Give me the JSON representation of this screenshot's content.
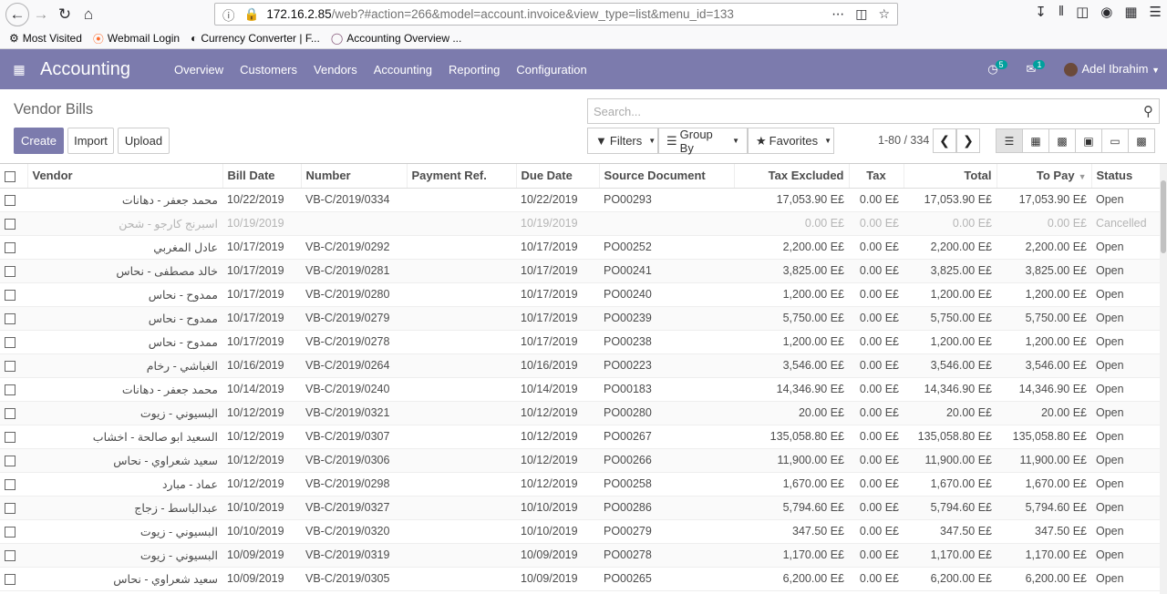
{
  "browser": {
    "url_host": "172.16.2.85",
    "url_path": "/web?#action=266&model=account.invoice&view_type=list&menu_id=133",
    "bookmarks": [
      "Most Visited",
      "Webmail Login",
      "Currency Converter | F...",
      "Accounting Overview ..."
    ]
  },
  "nav": {
    "app_name": "Accounting",
    "menu": [
      "Overview",
      "Customers",
      "Vendors",
      "Accounting",
      "Reporting",
      "Configuration"
    ],
    "activity_count": "5",
    "message_count": "1",
    "user_name": "Adel Ibrahim"
  },
  "control_panel": {
    "title": "Vendor Bills",
    "create_label": "Create",
    "import_label": "Import",
    "upload_label": "Upload",
    "search_placeholder": "Search...",
    "filters_label": "Filters",
    "groupby_label": "Group By",
    "favorites_label": "Favorites",
    "pager": "1-80 / 334"
  },
  "table": {
    "headers": [
      "Vendor",
      "Bill Date",
      "Number",
      "Payment Ref.",
      "Due Date",
      "Source Document",
      "Tax Excluded",
      "Tax",
      "Total",
      "To Pay",
      "Status"
    ],
    "rows": [
      [
        "محمد جعفر - دهانات",
        "10/22/2019",
        "VB-C/2019/0334",
        "",
        "10/22/2019",
        "PO00293",
        "17,053.90 E£",
        "0.00 E£",
        "17,053.90 E£",
        "17,053.90 E£",
        "Open"
      ],
      [
        "اسبرنج كارجو - شحن",
        "10/19/2019",
        "",
        "",
        "10/19/2019",
        "",
        "0.00 E£",
        "0.00 E£",
        "0.00 E£",
        "0.00 E£",
        "Cancelled"
      ],
      [
        "عادل المغربي",
        "10/17/2019",
        "VB-C/2019/0292",
        "",
        "10/17/2019",
        "PO00252",
        "2,200.00 E£",
        "0.00 E£",
        "2,200.00 E£",
        "2,200.00 E£",
        "Open"
      ],
      [
        "خالد مصطفى - نحاس",
        "10/17/2019",
        "VB-C/2019/0281",
        "",
        "10/17/2019",
        "PO00241",
        "3,825.00 E£",
        "0.00 E£",
        "3,825.00 E£",
        "3,825.00 E£",
        "Open"
      ],
      [
        "ممدوح - نحاس",
        "10/17/2019",
        "VB-C/2019/0280",
        "",
        "10/17/2019",
        "PO00240",
        "1,200.00 E£",
        "0.00 E£",
        "1,200.00 E£",
        "1,200.00 E£",
        "Open"
      ],
      [
        "ممدوح - نحاس",
        "10/17/2019",
        "VB-C/2019/0279",
        "",
        "10/17/2019",
        "PO00239",
        "5,750.00 E£",
        "0.00 E£",
        "5,750.00 E£",
        "5,750.00 E£",
        "Open"
      ],
      [
        "ممدوح - نحاس",
        "10/17/2019",
        "VB-C/2019/0278",
        "",
        "10/17/2019",
        "PO00238",
        "1,200.00 E£",
        "0.00 E£",
        "1,200.00 E£",
        "1,200.00 E£",
        "Open"
      ],
      [
        "الغباشي - رخام",
        "10/16/2019",
        "VB-C/2019/0264",
        "",
        "10/16/2019",
        "PO00223",
        "3,546.00 E£",
        "0.00 E£",
        "3,546.00 E£",
        "3,546.00 E£",
        "Open"
      ],
      [
        "محمد جعفر - دهانات",
        "10/14/2019",
        "VB-C/2019/0240",
        "",
        "10/14/2019",
        "PO00183",
        "14,346.90 E£",
        "0.00 E£",
        "14,346.90 E£",
        "14,346.90 E£",
        "Open"
      ],
      [
        "البسيوني - زيوت",
        "10/12/2019",
        "VB-C/2019/0321",
        "",
        "10/12/2019",
        "PO00280",
        "20.00 E£",
        "0.00 E£",
        "20.00 E£",
        "20.00 E£",
        "Open"
      ],
      [
        "السعيد ابو صالحة - اخشاب",
        "10/12/2019",
        "VB-C/2019/0307",
        "",
        "10/12/2019",
        "PO00267",
        "135,058.80 E£",
        "0.00 E£",
        "135,058.80 E£",
        "135,058.80 E£",
        "Open"
      ],
      [
        "سعيد شعراوي - نحاس",
        "10/12/2019",
        "VB-C/2019/0306",
        "",
        "10/12/2019",
        "PO00266",
        "11,900.00 E£",
        "0.00 E£",
        "11,900.00 E£",
        "11,900.00 E£",
        "Open"
      ],
      [
        "عماد - مبارد",
        "10/12/2019",
        "VB-C/2019/0298",
        "",
        "10/12/2019",
        "PO00258",
        "1,670.00 E£",
        "0.00 E£",
        "1,670.00 E£",
        "1,670.00 E£",
        "Open"
      ],
      [
        "عبدالباسط - زجاج",
        "10/10/2019",
        "VB-C/2019/0327",
        "",
        "10/10/2019",
        "PO00286",
        "5,794.60 E£",
        "0.00 E£",
        "5,794.60 E£",
        "5,794.60 E£",
        "Open"
      ],
      [
        "البسيوني - زيوت",
        "10/10/2019",
        "VB-C/2019/0320",
        "",
        "10/10/2019",
        "PO00279",
        "347.50 E£",
        "0.00 E£",
        "347.50 E£",
        "347.50 E£",
        "Open"
      ],
      [
        "البسيوني - زيوت",
        "10/09/2019",
        "VB-C/2019/0319",
        "",
        "10/09/2019",
        "PO00278",
        "1,170.00 E£",
        "0.00 E£",
        "1,170.00 E£",
        "1,170.00 E£",
        "Open"
      ],
      [
        "سعيد شعراوي - نحاس",
        "10/09/2019",
        "VB-C/2019/0305",
        "",
        "10/09/2019",
        "PO00265",
        "6,200.00 E£",
        "0.00 E£",
        "6,200.00 E£",
        "6,200.00 E£",
        "Open"
      ]
    ]
  }
}
